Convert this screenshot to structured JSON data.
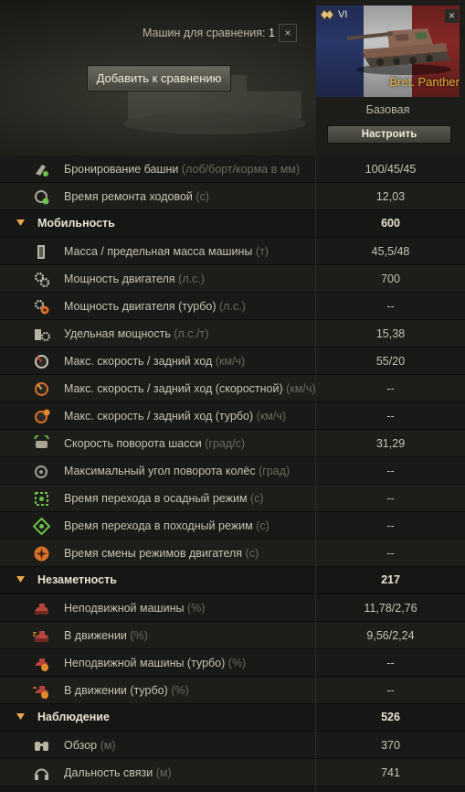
{
  "compare": {
    "label": "Машин для сравнения:",
    "count": "1",
    "close_glyph": "×"
  },
  "add_button": "Добавить к сравнению",
  "vehicle": {
    "tier": "VI",
    "name": "Bret. Panther",
    "configuration": "Базовая",
    "setup_button": "Настроить",
    "close_glyph": "×",
    "flag_colors": [
      "#2c3a6e",
      "#cfcfcf",
      "#8c2a28"
    ],
    "name_color": "#e6b23c"
  },
  "rows": [
    {
      "type": "stat",
      "icon": "turret-armor-icon",
      "label": "Бронирование башни",
      "unit": "(лоб/борт/корма в мм)",
      "value": "100/45/45"
    },
    {
      "type": "stat",
      "icon": "repair-time-icon",
      "label": "Время ремонта ходовой",
      "unit": "(с)",
      "value": "12,03"
    },
    {
      "type": "section",
      "label": "Мобильность",
      "value": "600"
    },
    {
      "type": "stat",
      "icon": "weight-icon",
      "label": "Масса / предельная масса машины",
      "unit": "(т)",
      "value": "45,5/48"
    },
    {
      "type": "stat",
      "icon": "engine-power-icon",
      "label": "Мощность двигателя",
      "unit": "(л.с.)",
      "value": "700"
    },
    {
      "type": "stat",
      "icon": "engine-power-turbo-icon",
      "label": "Мощность двигателя (турбо)",
      "unit": "(л.с.)",
      "value": "--"
    },
    {
      "type": "stat",
      "icon": "specific-power-icon",
      "label": "Удельная мощность",
      "unit": "(л.с./т)",
      "value": "15,38"
    },
    {
      "type": "stat",
      "icon": "speed-limit-icon",
      "label": "Макс. скорость / задний ход",
      "unit": "(км/ч)",
      "value": "55/20"
    },
    {
      "type": "stat",
      "icon": "speed-limit-fast-icon",
      "label": "Макс. скорость / задний ход (скоростной)",
      "unit": "(км/ч)",
      "value": "--"
    },
    {
      "type": "stat",
      "icon": "speed-limit-turbo-icon",
      "label": "Макс. скорость / задний ход (турбо)",
      "unit": "(км/ч)",
      "value": "--"
    },
    {
      "type": "stat",
      "icon": "traverse-speed-icon",
      "label": "Скорость поворота шасси",
      "unit": "(град/с)",
      "value": "31,29"
    },
    {
      "type": "stat",
      "icon": "wheel-angle-icon",
      "label": "Максимальный угол поворота колёс",
      "unit": "(град)",
      "value": "--"
    },
    {
      "type": "stat",
      "icon": "siege-mode-icon",
      "label": "Время перехода в осадный режим ",
      "unit": "(с)",
      "value": "--"
    },
    {
      "type": "stat",
      "icon": "travel-mode-icon",
      "label": "Время перехода в походный режим ",
      "unit": "(с)",
      "value": "--"
    },
    {
      "type": "stat",
      "icon": "engine-mode-switch-icon",
      "label": "Время смены режимов двигателя",
      "unit": "(с)",
      "value": "--"
    },
    {
      "type": "section",
      "label": "Незаметность",
      "value": "217"
    },
    {
      "type": "stat",
      "icon": "camo-still-icon",
      "label": "Неподвижной машины",
      "unit": "(%)",
      "value": "11,78/2,76"
    },
    {
      "type": "stat",
      "icon": "camo-moving-icon",
      "label": "В движении",
      "unit": "(%)",
      "value": "9,56/2,24"
    },
    {
      "type": "stat",
      "icon": "camo-still-turbo-icon",
      "label": "Неподвижной машины (турбо)",
      "unit": "(%)",
      "value": "--"
    },
    {
      "type": "stat",
      "icon": "camo-moving-turbo-icon",
      "label": "В движении (турбо)",
      "unit": "(%)",
      "value": "--"
    },
    {
      "type": "section",
      "label": "Наблюдение",
      "value": "526"
    },
    {
      "type": "stat",
      "icon": "view-range-icon",
      "label": "Обзор",
      "unit": "(м)",
      "value": "370"
    },
    {
      "type": "stat",
      "icon": "radio-range-icon",
      "label": "Дальность связи",
      "unit": "(м)",
      "value": "741"
    }
  ]
}
